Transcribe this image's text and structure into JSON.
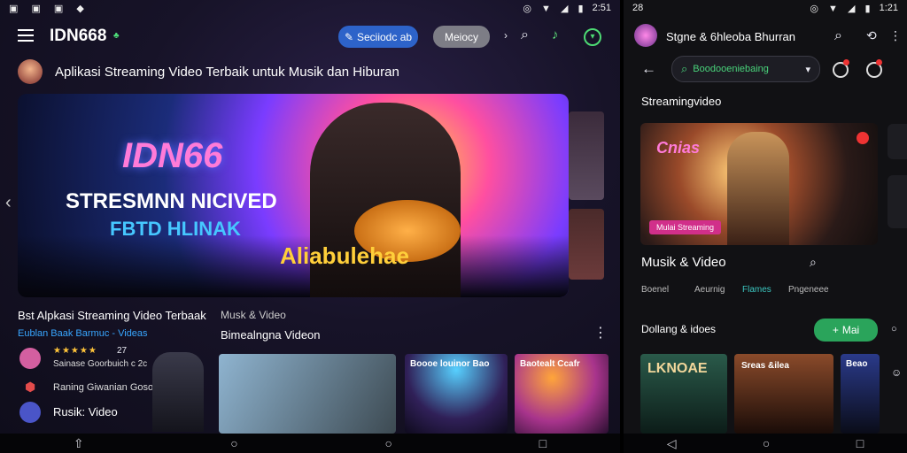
{
  "left": {
    "status": {
      "right": "2:51"
    },
    "brand": "IDN668",
    "buttons": {
      "search_label": "Seciiodc ab",
      "menu_label": "Meiocy"
    },
    "subtitle": "Aplikasi Streaming Video Terbaik untuk Musik dan Hiburan",
    "hero": {
      "logo": "IDN66",
      "line1": "STRESMNN NICIVED",
      "line2": "FBTD HLINAK",
      "graffiti": "Aliabulehae"
    },
    "left_block": {
      "title": "Bst Alpkasi Streaming Video Terbaak",
      "link": "Eublan Baak Barmuc - Videas",
      "rating": "27",
      "items": [
        "Sainase Goorbuich c 2c",
        "Raning Giwanian Gosobt",
        "Rusik: Video"
      ]
    },
    "music": {
      "label": "Musk & Video",
      "title": "Bimealngna Videon",
      "cards": [
        "",
        "Boooe louinor Bao",
        "Baotealt Ccafr"
      ]
    }
  },
  "right": {
    "status": {
      "left": "28",
      "right": "1:21"
    },
    "title": "Stgne & 6hleoba Bhurran",
    "search_placeholder": "Boodooeniebaing",
    "section": "Streamingvideo",
    "hero_badge": "Mulai Streaming",
    "hero_logo": "Cnias",
    "music_title": "Musik & Video",
    "tabs": [
      "Boenel",
      "Aeurnig",
      "Flames",
      "Pngeneee"
    ],
    "subhead": "Dollang & idoes",
    "green_button": "Mai",
    "cards": [
      "LKNOAE",
      "Sreas &ilea",
      "Beao"
    ]
  }
}
